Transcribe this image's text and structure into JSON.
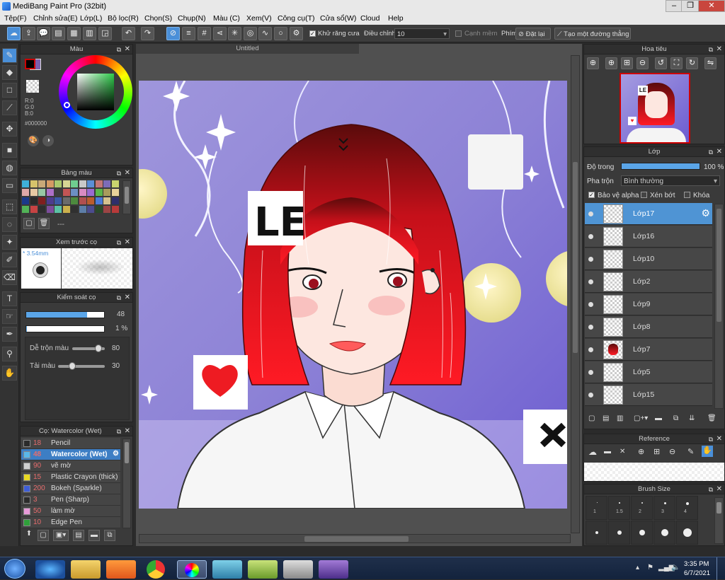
{
  "window": {
    "title": "MediBang Paint Pro (32bit)"
  },
  "menu": [
    "Tệp(F)",
    "Chỉnh sửa(E)",
    "Lớp(L)",
    "Bộ lọc(R)",
    "Chọn(S)",
    "Chụp(N)",
    "Màu (C)",
    "Xem(V)",
    "Công cụ(T)",
    "Cửa sổ(W)",
    "Cloud",
    "Help"
  ],
  "toolbar": {
    "antialias_label": "Khử răng cưa",
    "adjust_label": "Điều chỉnh",
    "adjust_value": "10",
    "soft_edge_label": "Cạnh mềm",
    "key_label": "Phím",
    "reset_label": "Đặt lại",
    "straight_line_label": "Tạo một đường thẳng"
  },
  "color_panel": {
    "title": "Màu",
    "r": "R:0",
    "g": "G:0",
    "b": "B:0",
    "hex": "#000000"
  },
  "palette_panel": {
    "title": "Bảng màu",
    "name": "---",
    "swatches": [
      "#3fb0d9",
      "#d6c36b",
      "#c9a978",
      "#d59a64",
      "#a9c86d",
      "#d6d694",
      "#6fcd8f",
      "#c9c9c9",
      "#5b8fd6",
      "#c27676",
      "#7d6cb8",
      "#c9d36e",
      "#e0a9a9",
      "#e7c9a3",
      "#98c7a4",
      "#ad70c7",
      "#3d3d3d",
      "#c25555",
      "#6c8fc2",
      "#d98bc2",
      "#9a6ad1",
      "#59b54a",
      "#a89c5c",
      "#e7d19a",
      "#1b3a8a",
      "#2a2a2a",
      "#7f1f1f",
      "#4d3c8f",
      "#3b5aa6",
      "#6b6b6b",
      "#4d8a3e",
      "#b04f4f",
      "#ba5c2e",
      "#4a7bd8",
      "#d4c28f",
      "#2f2f6b",
      "#52b357",
      "#c74343",
      "#2e2e2e",
      "#7c4d9b",
      "#5bc2a5",
      "#ccb14d",
      "#303030",
      "#5d7ea8",
      "#4c4c8f",
      "#2a4a2a",
      "#9b4545",
      "#b83a3a"
    ]
  },
  "preview_panel": {
    "title": "Xem trước cọ",
    "size": "3.54mm"
  },
  "brush_control": {
    "title": "Kiểm soát cọ",
    "size_value": "48",
    "size_fill": 0.78,
    "opacity_value": "1 %",
    "opacity_fill": 0.01,
    "mix_label": "Dễ trộn màu",
    "mix_value": "80",
    "load_label": "Tải màu",
    "load_value": "30"
  },
  "brush_list": {
    "title": "Cọ: Watercolor (Wet)",
    "items": [
      {
        "size": "18",
        "name": "Pencil",
        "color": "#2b2b2b"
      },
      {
        "size": "48",
        "name": "Watercolor (Wet)",
        "color": "#59b7ea"
      },
      {
        "size": "90",
        "name": "vẽ mờ",
        "color": "#cfcfcf"
      },
      {
        "size": "15",
        "name": "Plastic Crayon (thick)",
        "color": "#e8d923"
      },
      {
        "size": "200",
        "name": "Bokeh (Sparkle)",
        "color": "#3f5ed6"
      },
      {
        "size": "3",
        "name": "Pen (Sharp)",
        "color": "#2b2b2b"
      },
      {
        "size": "50",
        "name": "làm mờ",
        "color": "#e89ad9"
      },
      {
        "size": "10",
        "name": "Edge Pen",
        "color": "#2fa03a"
      }
    ]
  },
  "canvas": {
    "tab": "Untitled",
    "sticker_text": "LE"
  },
  "navigator_panel": {
    "title": "Hoa tiêu",
    "sticker_text": "LE"
  },
  "layer_panel": {
    "title": "Lớp",
    "opacity_label": "Độ trong",
    "opacity_value": "100 %",
    "blend_label": "Pha trộn",
    "blend_value": "Bình thường",
    "protect_alpha": "Bảo vệ alpha",
    "clipping": "Xén bớt",
    "lock": "Khóa",
    "layers": [
      "Lớp17",
      "Lớp16",
      "Lớp10",
      "Lớp2",
      "Lớp9",
      "Lớp8",
      "Lớp7",
      "Lớp5",
      "Lớp15"
    ]
  },
  "reference_panel": {
    "title": "Reference"
  },
  "brush_size_panel": {
    "title": "Brush Size",
    "labels": [
      "1",
      "1.5",
      "2",
      "3",
      "4"
    ]
  },
  "taskbar": {
    "time": "3:35 PM",
    "date": "6/7/2021"
  }
}
